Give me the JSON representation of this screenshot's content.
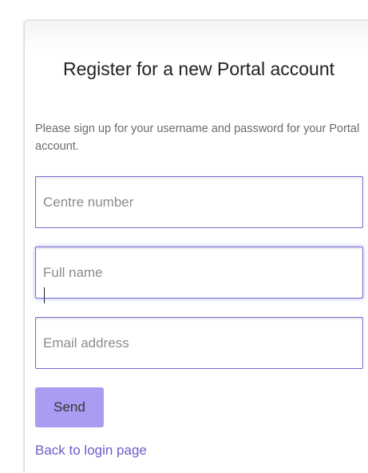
{
  "form": {
    "title": "Register for a new Portal account",
    "subtitle": "Please sign up for your username and password for your Portal account.",
    "fields": [
      {
        "placeholder": "Centre number",
        "value": ""
      },
      {
        "placeholder": "Full name",
        "value": ""
      },
      {
        "placeholder": "Email address",
        "value": ""
      }
    ],
    "send_label": "Send",
    "back_link_label": "Back to login page"
  },
  "colors": {
    "field_border": "#7f6ad6",
    "button_background": "#a99cf2",
    "link": "#6d5bc8"
  }
}
